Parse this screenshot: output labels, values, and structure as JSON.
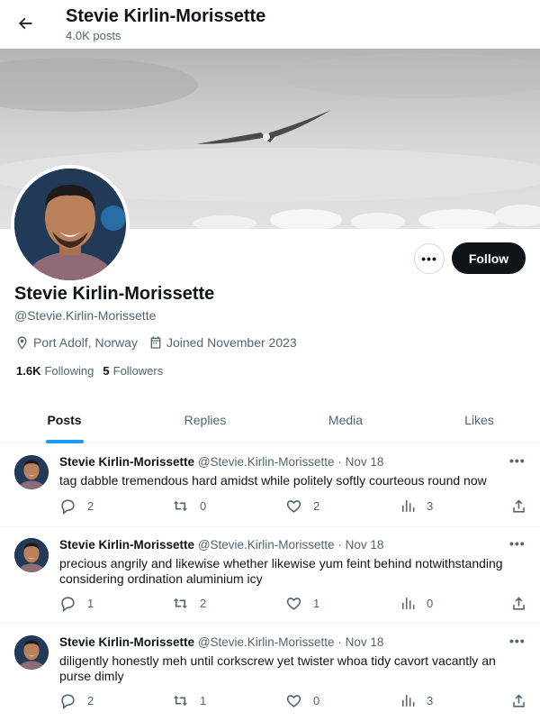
{
  "header": {
    "title": "Stevie Kirlin-Morissette",
    "subtitle": "4.0K posts"
  },
  "profile": {
    "name": "Stevie Kirlin-Morissette",
    "handle": "@Stevie.Kirlin-Morissette",
    "location": "Port Adolf, Norway",
    "joined": "Joined November 2023",
    "following_count": "1.6K",
    "following_label": "Following",
    "followers_count": "5",
    "followers_label": "Followers",
    "follow_label": "Follow",
    "more_label": "•••"
  },
  "tabs": [
    {
      "label": "Posts",
      "active": true
    },
    {
      "label": "Replies",
      "active": false
    },
    {
      "label": "Media",
      "active": false
    },
    {
      "label": "Likes",
      "active": false
    }
  ],
  "posts": [
    {
      "name": "Stevie Kirlin-Morissette",
      "handle": "@Stevie.Kirlin-Morissette",
      "date": "· Nov 18",
      "text": "tag dabble tremendous hard amidst while politely softly courteous round now",
      "replies": "2",
      "reposts": "0",
      "likes": "2",
      "views": "3"
    },
    {
      "name": "Stevie Kirlin-Morissette",
      "handle": "@Stevie.Kirlin-Morissette",
      "date": "· Nov 18",
      "text": "precious angrily and likewise whether likewise yum feint behind notwithstanding considering ordination aluminium icy",
      "replies": "1",
      "reposts": "2",
      "likes": "1",
      "views": "0"
    },
    {
      "name": "Stevie Kirlin-Morissette",
      "handle": "@Stevie.Kirlin-Morissette",
      "date": "· Nov 18",
      "text": "diligently honestly meh until corkscrew yet twister whoa tidy cavort vacantly an purse dimly",
      "replies": "2",
      "reposts": "1",
      "likes": "0",
      "views": "3"
    }
  ],
  "colors": {
    "accent": "#1d9bf0",
    "text_primary": "#0f1419",
    "text_secondary": "#536471",
    "button_dark": "#0f1419"
  },
  "icons": {
    "back": "arrow-left-icon",
    "location": "location-pin-icon",
    "calendar": "calendar-icon",
    "reply": "reply-bubble-icon",
    "repost": "repost-icon",
    "like": "heart-icon",
    "views": "bar-chart-icon",
    "share": "share-upload-icon"
  }
}
